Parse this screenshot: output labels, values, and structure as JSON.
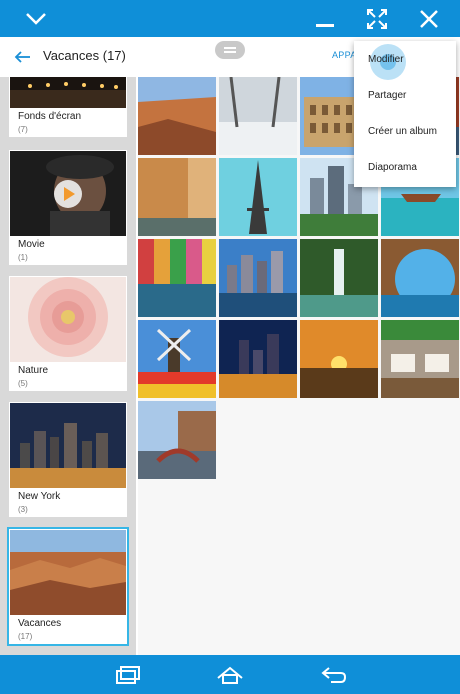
{
  "topbar": {
    "icons": [
      "chevron-down-icon",
      "minimize-icon",
      "fullscreen-icon",
      "close-icon"
    ]
  },
  "appbar": {
    "title": "Vacances (17)",
    "action_label": "APPA"
  },
  "albums": [
    {
      "name": "Fonds d'écran",
      "count": "(7)",
      "image": "night-boardwalk"
    },
    {
      "name": "Movie",
      "count": "(1)",
      "image": "man-with-hat-play"
    },
    {
      "name": "Nature",
      "count": "(5)",
      "image": "pink-flower"
    },
    {
      "name": "New York",
      "count": "(3)",
      "image": "city-night-skyline"
    },
    {
      "name": "Vacances",
      "count": "(17)",
      "image": "canyon",
      "selected": true
    }
  ],
  "photos": [
    "canyon",
    "snowy-park",
    "colosseum",
    "red-cliffs",
    "canal-houses",
    "eiffel-tower",
    "skyscrapers",
    "tropical-boat",
    "colorful-canal",
    "harbor-skyline",
    "waterfall",
    "sea-cave",
    "windmill-tulips",
    "night-waterfront",
    "sunset-beach",
    "restaurant-terrace",
    "bridge-canal"
  ],
  "menu": {
    "items": [
      "Modifier",
      "Partager",
      "Créer un album",
      "Diaporama"
    ]
  },
  "navbar": {
    "icons": [
      "recent-apps-icon",
      "home-icon",
      "back-icon"
    ]
  },
  "colors": {
    "bar": "#0f8fd8",
    "accent": "#1a8fd6",
    "selection": "#36b6e6"
  }
}
